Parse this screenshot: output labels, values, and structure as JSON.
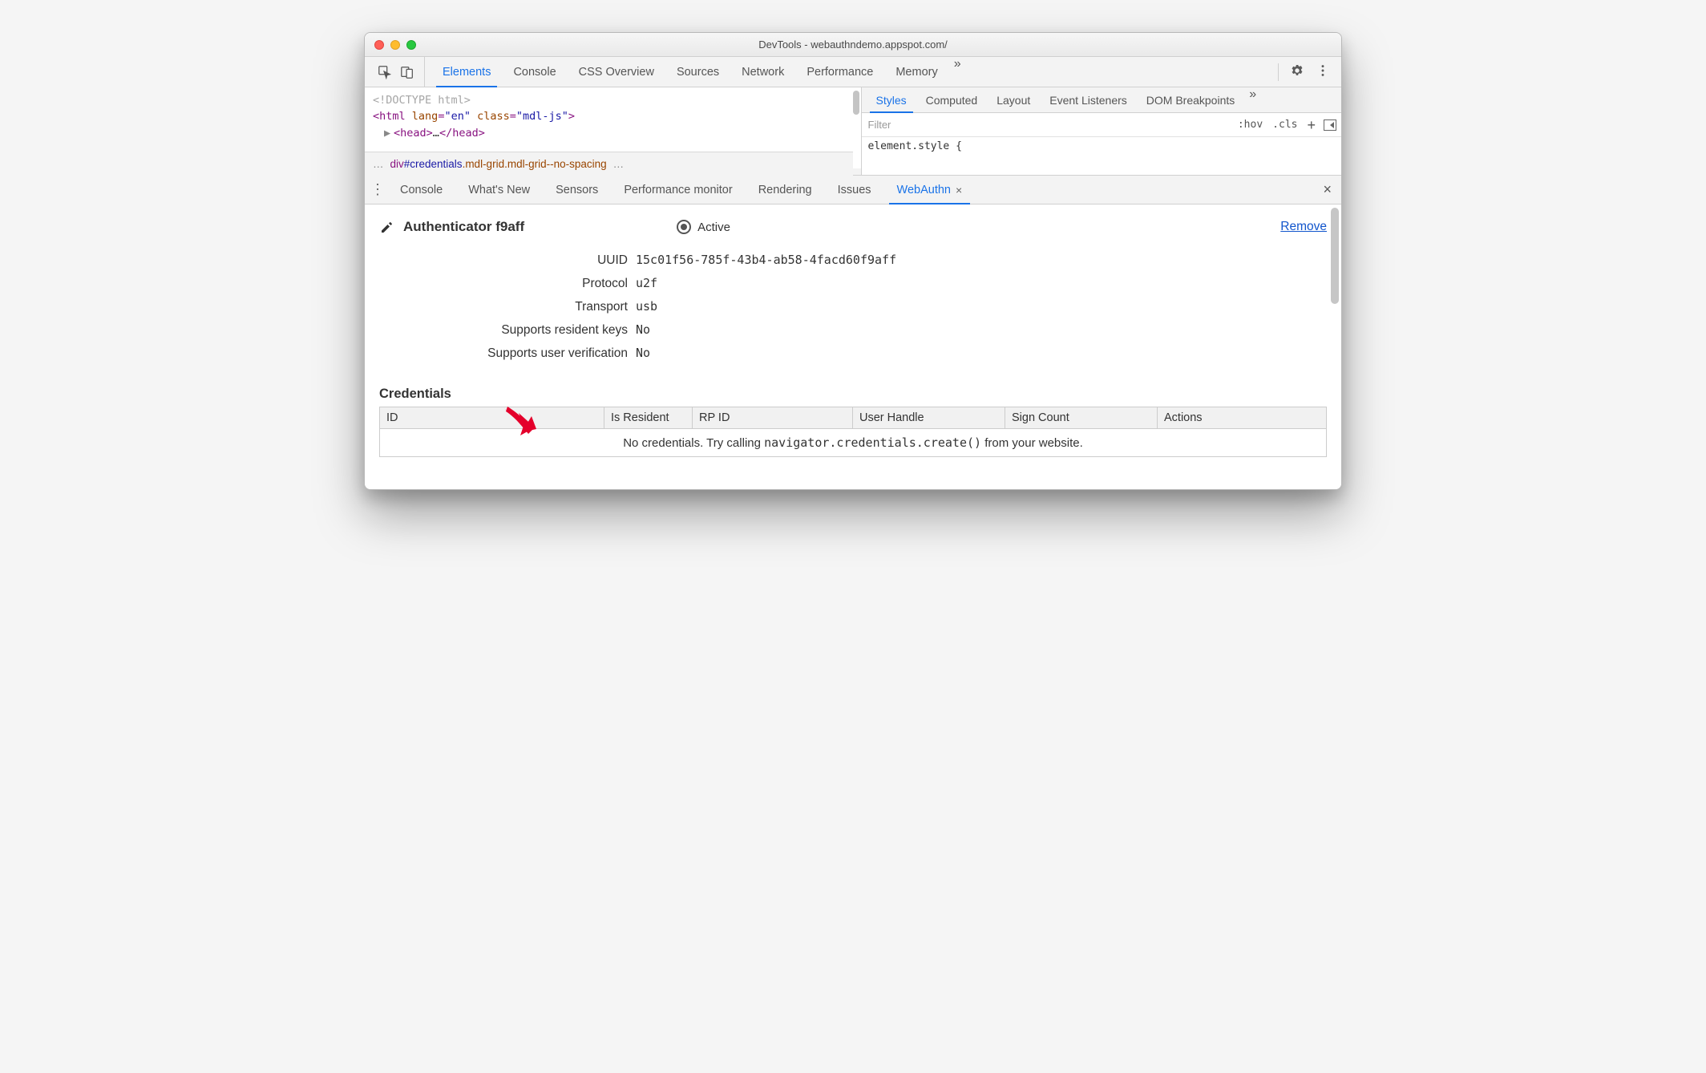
{
  "window": {
    "title": "DevTools - webauthndemo.appspot.com/"
  },
  "toolbar": {
    "tabs": [
      "Elements",
      "Console",
      "CSS Overview",
      "Sources",
      "Network",
      "Performance",
      "Memory"
    ],
    "active": 0,
    "more": "»"
  },
  "dom": {
    "line1": "<!DOCTYPE html>",
    "line2_open": "<",
    "line2_tag": "html",
    "line2_attr1_name": "lang",
    "line2_attr1_val": "\"en\"",
    "line2_attr2_name": "class",
    "line2_attr2_val": "\"mdl-js\"",
    "line2_close": ">",
    "line3_pre": "▶",
    "line3_open": "<",
    "line3_tag": "head",
    "line3_mid": ">",
    "line3_ell": "…",
    "line3_end_open": "</",
    "line3_end_tag": "head",
    "line3_end_close": ">"
  },
  "breadcrumb": {
    "left": "…",
    "tag": "div",
    "id": "#credentials",
    "cls": ".mdl-grid.mdl-grid--no-spacing",
    "right": "…"
  },
  "styles": {
    "tabs": [
      "Styles",
      "Computed",
      "Layout",
      "Event Listeners",
      "DOM Breakpoints"
    ],
    "active": 0,
    "more": "»",
    "filter_placeholder": "Filter",
    "hov": ":hov",
    "cls": ".cls",
    "code": "element.style {"
  },
  "drawer": {
    "tabs": [
      "Console",
      "What's New",
      "Sensors",
      "Performance monitor",
      "Rendering",
      "Issues",
      "WebAuthn"
    ],
    "active": 6,
    "close_x": "×"
  },
  "auth": {
    "name": "Authenticator f9aff",
    "active_label": "Active",
    "remove": "Remove",
    "props": [
      {
        "label": "UUID",
        "value": "15c01f56-785f-43b4-ab58-4facd60f9aff"
      },
      {
        "label": "Protocol",
        "value": "u2f"
      },
      {
        "label": "Transport",
        "value": "usb"
      },
      {
        "label": "Supports resident keys",
        "value": "No"
      },
      {
        "label": "Supports user verification",
        "value": "No"
      }
    ]
  },
  "credentials": {
    "heading": "Credentials",
    "columns": [
      "ID",
      "Is Resident",
      "RP ID",
      "User Handle",
      "Sign Count",
      "Actions"
    ],
    "empty_pre": "No credentials. Try calling ",
    "empty_code": "navigator.credentials.create()",
    "empty_post": " from your website."
  }
}
